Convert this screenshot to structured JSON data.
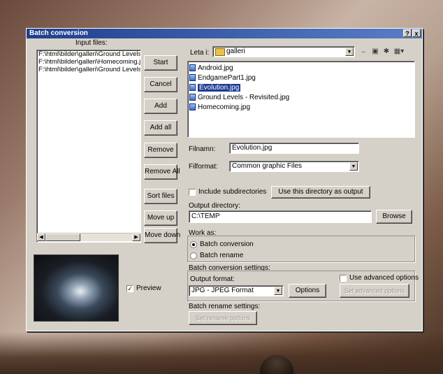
{
  "window": {
    "title": "Batch conversion",
    "help_label": "?",
    "close_label": "x"
  },
  "input_files": {
    "label": "Input files:",
    "items": [
      "F:\\html\\bilder\\galleri\\Ground Levels - F",
      "F:\\html\\bilder\\galleri\\Homecoming.jpg",
      "F:\\html\\bilder\\galleri\\Ground Levels - F"
    ]
  },
  "buttons": {
    "start": "Start",
    "cancel": "Cancel",
    "add": "Add",
    "add_all": "Add all",
    "remove": "Remove",
    "remove_all": "Remove All",
    "sort_files": "Sort files",
    "move_up": "Move up",
    "move_down": "Move down"
  },
  "look_in": {
    "label": "Leta i:",
    "value": "galleri"
  },
  "toolbar_icons": [
    "back-arrow-icon",
    "up-folder-icon",
    "new-folder-icon",
    "view-menu-icon"
  ],
  "files": [
    {
      "name": "Android.jpg",
      "selected": false
    },
    {
      "name": "EndgamePart1.jpg",
      "selected": false
    },
    {
      "name": "Evolution.jpg",
      "selected": true
    },
    {
      "name": "Ground Levels - Revisited.jpg",
      "selected": false
    },
    {
      "name": "Homecoming.jpg",
      "selected": false
    }
  ],
  "filename": {
    "label": "Filnamn:",
    "value": "Evolution.jpg"
  },
  "fileformat": {
    "label": "Filformat:",
    "value": "Common graphic Files"
  },
  "include_subdirs": {
    "label": "Include subdirectories",
    "checked": false
  },
  "use_dir_button": "Use this directory as output",
  "output_directory": {
    "label": "Output directory:",
    "value": "C:\\TEMP",
    "browse": "Browse"
  },
  "work_as": {
    "label": "Work as:",
    "options": [
      {
        "label": "Batch conversion",
        "selected": true
      },
      {
        "label": "Batch rename",
        "selected": false
      }
    ]
  },
  "conversion_settings": {
    "label": "Batch conversion settings:",
    "output_format_label": "Output format:",
    "output_format_value": "JPG - JPEG Format",
    "options_button": "Options",
    "advanced_checkbox": "Use advanced options",
    "advanced_button": "Set advanced options"
  },
  "rename_settings": {
    "label": "Batch rename settings:",
    "button": "Set rename options"
  },
  "preview": {
    "label": "Preview",
    "checked": true
  }
}
